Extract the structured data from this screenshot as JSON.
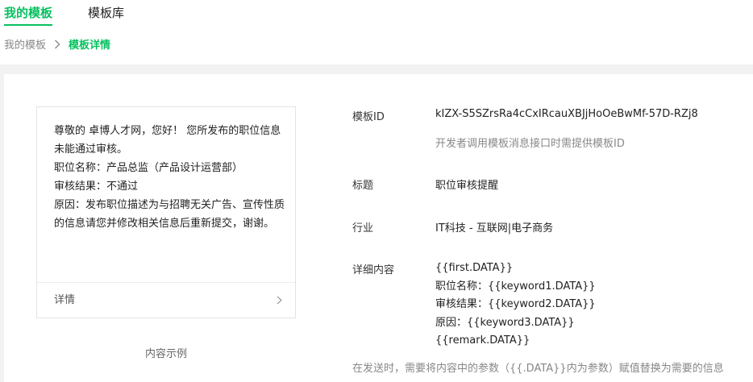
{
  "tabs": [
    {
      "label": "我的模板",
      "active": true
    },
    {
      "label": "模板库",
      "active": false
    }
  ],
  "breadcrumb": {
    "parent": "我的模板",
    "current": "模板详情"
  },
  "preview": {
    "lines": [
      "尊敬的 卓博人才网，您好！ 您所发布的职位信息未能通过审核。",
      "职位名称：产品总监（产品设计运营部）",
      "审核结果：不通过",
      "原因：发布职位描述为与招聘无关广告、宣传性质的信息请您并修改相关信息后重新提交，谢谢。"
    ],
    "footer_label": "详情",
    "caption": "内容示例"
  },
  "details": {
    "template_id_label": "模板ID",
    "template_id_value": "kIZX-S5SZrsRa4cCxIRcauXBJjHoOeBwMf-57D-RZj8",
    "template_id_hint": "开发者调用模板消息接口时需提供模板ID",
    "title_label": "标题",
    "title_value": "职位审核提醒",
    "industry_label": "行业",
    "industry_value": "IT科技 - 互联网|电子商务",
    "content_label": "详细内容",
    "content_lines": [
      "{{first.DATA}}",
      "职位名称：{{keyword1.DATA}}",
      "审核结果：{{keyword2.DATA}}",
      "原因：{{keyword3.DATA}}",
      "{{remark.DATA}}"
    ],
    "bottom_note": "在发送时，需要将内容中的参数（{{.DATA}}内为参数）赋值替换为需要的信息"
  },
  "colors": {
    "accent": "#07c160",
    "band": "#f2f2f2"
  },
  "icons": {
    "breadcrumb_separator": "chevron-right-icon",
    "preview_footer": "chevron-right-icon"
  }
}
